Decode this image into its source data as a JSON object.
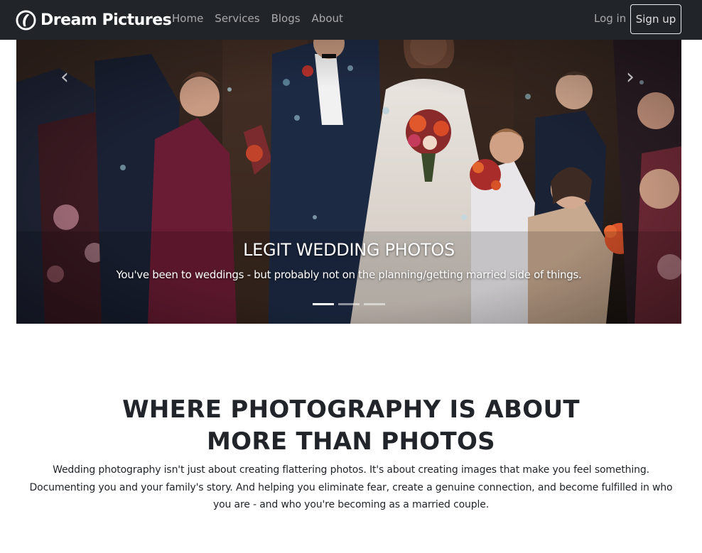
{
  "brand": {
    "name": "Dream Pictures",
    "icon": "camera-aperture-icon"
  },
  "nav": {
    "links": [
      "Home",
      "Services",
      "Blogs",
      "About"
    ],
    "login_label": "Log in",
    "signup_label": "Sign up"
  },
  "carousel": {
    "active_slide": 1,
    "slide_count": 3,
    "caption_title": "LEGIT WEDDING PHOTOS",
    "caption_text": "You've been to weddings - but probably not on the planning/getting married side of things.",
    "prev_icon": "chevron-left-icon",
    "next_icon": "chevron-right-icon"
  },
  "intro": {
    "heading_line1": "WHERE PHOTOGRAPHY IS ABOUT",
    "heading_line2": "MORE THAN PHOTOS",
    "text": "Wedding photography isn't just about creating flattering photos. It's about creating images that make you feel something. Documenting you and your family's story. And helping you eliminate fear, create a genuine connection, and become fulfilled in who you are - and who you're becoming as a married couple."
  },
  "colors": {
    "navbar_bg": "#212529",
    "page_bg": "#ffffff",
    "text": "#212529"
  }
}
